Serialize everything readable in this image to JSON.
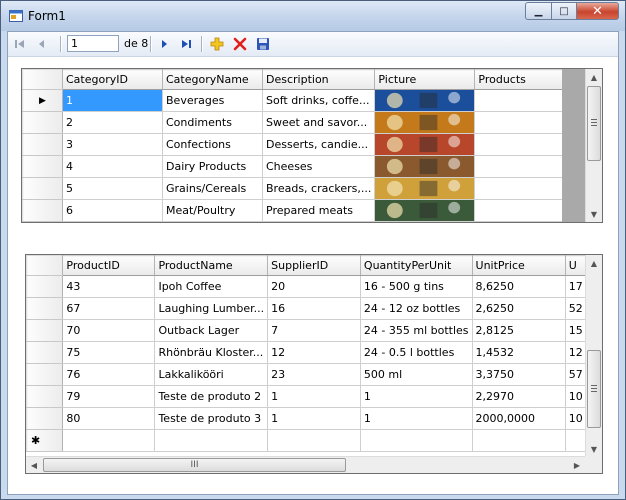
{
  "window": {
    "title": "Form1",
    "minimize_glyph": "▁",
    "maximize_glyph": "□",
    "close_glyph": "✕"
  },
  "navigator": {
    "position": "1",
    "of_label": "de 8",
    "icons": [
      "move-first-icon",
      "move-previous-icon",
      "move-next-icon",
      "move-last-icon",
      "add-new-icon",
      "delete-icon",
      "save-icon"
    ]
  },
  "categories": {
    "columns": [
      "CategoryID",
      "CategoryName",
      "Description",
      "Picture",
      "Products"
    ],
    "rows": [
      {
        "id": "1",
        "name": "Beverages",
        "desc": "Soft drinks, coffe...",
        "current": true
      },
      {
        "id": "2",
        "name": "Condiments",
        "desc": "Sweet and savor..."
      },
      {
        "id": "3",
        "name": "Confections",
        "desc": "Desserts, candie..."
      },
      {
        "id": "4",
        "name": "Dairy Products",
        "desc": "Cheeses"
      },
      {
        "id": "5",
        "name": "Grains/Cereals",
        "desc": "Breads, crackers,..."
      },
      {
        "id": "6",
        "name": "Meat/Poultry",
        "desc": "Prepared meats"
      }
    ],
    "current_row_glyph": "▶",
    "picture_colors": [
      "#1b4f9c",
      "#c47a1a",
      "#b8462a",
      "#8a5a2e",
      "#d0a13a",
      "#3b5a3a"
    ]
  },
  "products": {
    "columns": [
      "ProductID",
      "ProductName",
      "SupplierID",
      "QuantityPerUnit",
      "UnitPrice",
      "U"
    ],
    "rows": [
      [
        "43",
        "Ipoh Coffee",
        "20",
        "16 - 500 g tins",
        "8,6250",
        "17"
      ],
      [
        "67",
        "Laughing Lumber...",
        "16",
        "24 - 12 oz bottles",
        "2,6250",
        "52"
      ],
      [
        "70",
        "Outback Lager",
        "7",
        "24 - 355 ml bottles",
        "2,8125",
        "15"
      ],
      [
        "75",
        "Rhönbräu Kloster...",
        "12",
        "24 - 0.5 l bottles",
        "1,4532",
        "12"
      ],
      [
        "76",
        "Lakkalikööri",
        "23",
        "500 ml",
        "3,3750",
        "57"
      ],
      [
        "79",
        "Teste de produto 2",
        "1",
        "1",
        "2,2970",
        "10"
      ],
      [
        "80",
        "Teste de produto 3",
        "1",
        "1",
        "2000,0000",
        "10"
      ]
    ],
    "new_row_glyph": "✱",
    "scroll_grip": "III"
  }
}
